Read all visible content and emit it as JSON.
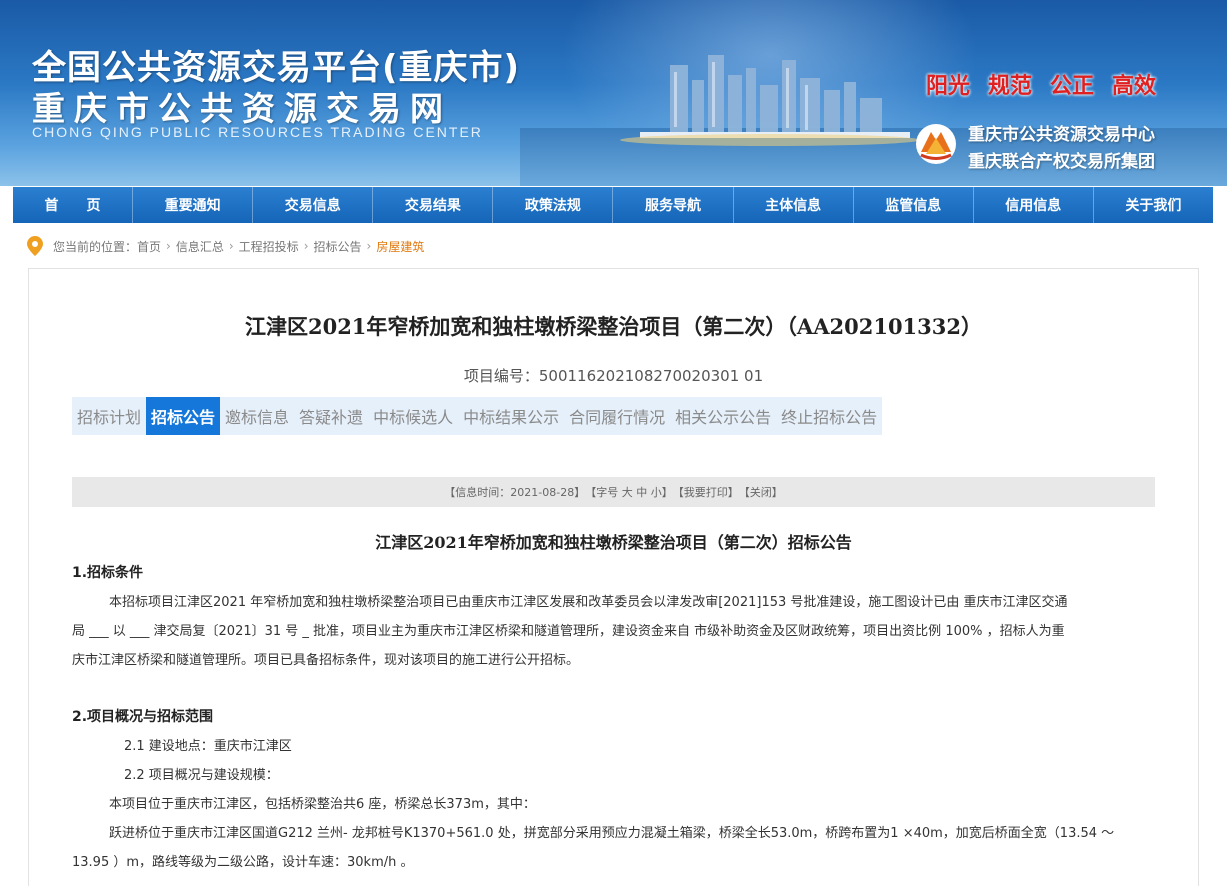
{
  "banner": {
    "title_cn": "全国公共资源交易平台(重庆市)",
    "subtitle_cn": "重庆市公共资源交易网",
    "title_en": "CHONG QING PUBLIC RESOURCES TRADING CENTER",
    "slogans": [
      "阳光",
      "规范",
      "公正",
      "高效"
    ],
    "org_line1": "重庆市公共资源交易中心",
    "org_line2": "重庆联合产权交易所集团"
  },
  "nav": {
    "items": [
      "首　　页",
      "重要通知",
      "交易信息",
      "交易结果",
      "政策法规",
      "服务导航",
      "主体信息",
      "监管信息",
      "信用信息",
      "关于我们"
    ]
  },
  "breadcrumb": {
    "prefix": "您当前的位置：",
    "items": [
      "首页",
      "信息汇总",
      "工程招投标",
      "招标公告",
      "房屋建筑"
    ],
    "separator": "›"
  },
  "project": {
    "title": "江津区2021年窄桥加宽和独柱墩桥梁整治项目（第二次）（AA202101332）",
    "code_label": "项目编号：",
    "code_value": "500116202108270020301 01"
  },
  "tabs": {
    "items": [
      "招标计划",
      "招标公告",
      "邀标信息",
      "答疑补遗",
      "中标候选人",
      "中标结果公示",
      "合同履行情况",
      "相关公示公告",
      "终止招标公告"
    ],
    "active_index": 1
  },
  "info_bar": {
    "time": "【信息时间：2021-08-28】",
    "font_size": "【字号 大 中 小】",
    "print": "【我要打印】",
    "close": "【关闭】"
  },
  "announcement": {
    "title": "江津区2021年窄桥加宽和独柱墩桥梁整治项目（第二次）招标公告",
    "sec1_head": "1.招标条件",
    "sec1_p1": "本招标项目江津区2021 年窄桥加宽和独柱墩桥梁整治项目已由重庆市江津区发展和改革委员会以津发改审[2021]153 号批准建设，施工图设计已由 重庆市江津区交通",
    "sec1_p2": "局 ___ 以 ___ 津交局复〔2021〕31 号 _ 批准，项目业主为重庆市江津区桥梁和隧道管理所，建设资金来自 市级补助资金及区财政统筹，项目出资比例 100% ，招标人为重",
    "sec1_p3": "庆市江津区桥梁和隧道管理所。项目已具备招标条件，现对该项目的施工进行公开招标。",
    "sec2_head": "2.项目概况与招标范围",
    "sec2_1": "2.1  建设地点：重庆市江津区",
    "sec2_2": "2.2  项目概况与建设规模：",
    "sec2_p1": "本项目位于重庆市江津区，包括桥梁整治共6 座，桥梁总长373m，其中：",
    "sec2_p2": "跃进桥位于重庆市江津区国道G212 兰州- 龙邦桩号K1370+561.0 处，拼宽部分采用预应力混凝土箱梁，桥梁全长53.0m，桥跨布置为1 ×40m，加宽后桥面全宽（13.54 ～",
    "sec2_p3": "13.95 ）m，路线等级为二级公路，设计车速：30km/h 。"
  },
  "colors": {
    "nav_bg": "#1565b8",
    "tab_active": "#1577d9",
    "slogan": "#e02020",
    "crumb_current": "#e07a10"
  }
}
